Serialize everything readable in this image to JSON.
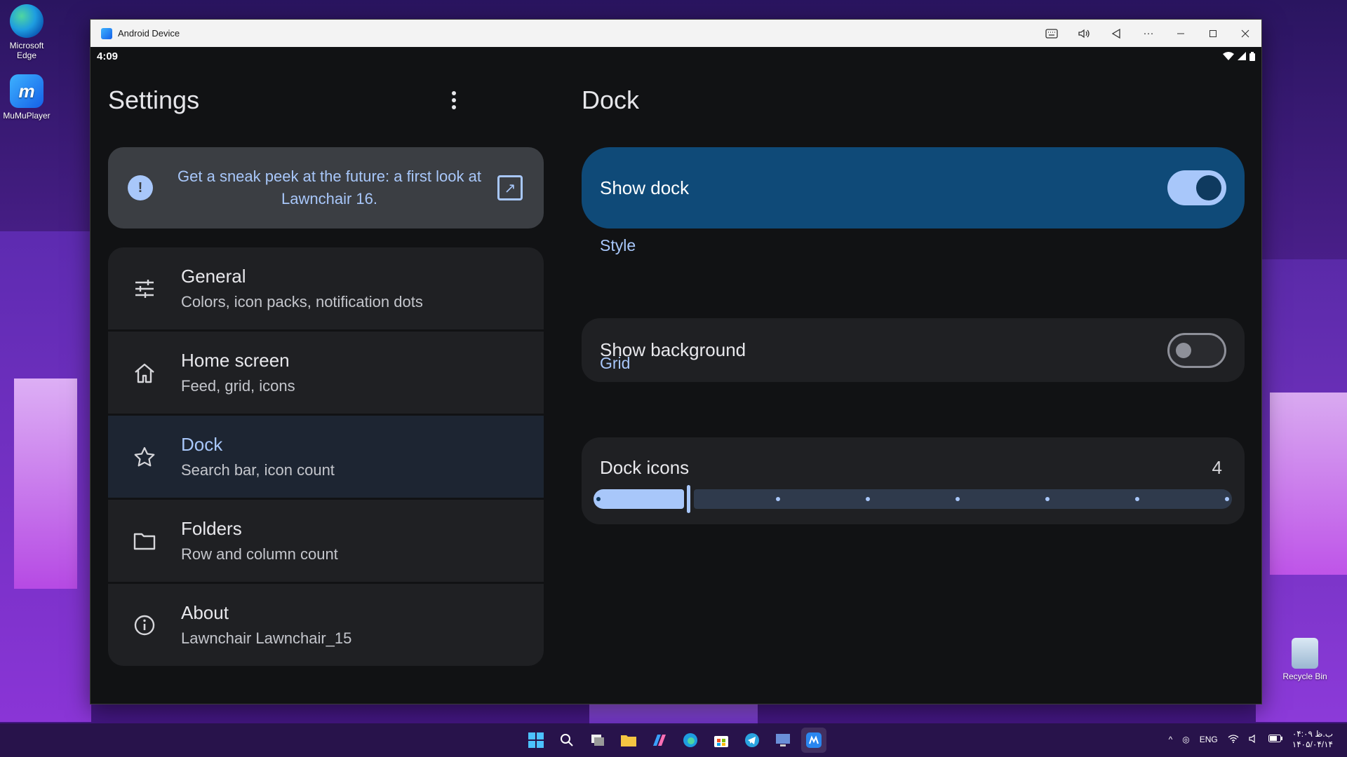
{
  "desktop": {
    "icons": [
      {
        "label": "Microsoft Edge"
      },
      {
        "label": "MuMuPlayer"
      },
      {
        "label": "Recycle Bin"
      }
    ]
  },
  "window": {
    "title": "Android Device",
    "controls": [
      "keyboard-icon",
      "volume-icon",
      "back-icon",
      "more-icon",
      "minimize-icon",
      "maximize-icon",
      "close-icon"
    ]
  },
  "statusbar": {
    "time": "4:09"
  },
  "settings": {
    "title": "Settings",
    "banner": {
      "text": "Get a sneak peek at the future: a first look at Lawnchair 16."
    },
    "items": [
      {
        "title": "General",
        "subtitle": "Colors, icon packs, notification dots",
        "icon": "sliders-icon"
      },
      {
        "title": "Home screen",
        "subtitle": "Feed, grid, icons",
        "icon": "home-icon"
      },
      {
        "title": "Dock",
        "subtitle": "Search bar, icon count",
        "icon": "star-icon",
        "active": true
      },
      {
        "title": "Folders",
        "subtitle": "Row and column count",
        "icon": "folder-icon"
      },
      {
        "title": "About",
        "subtitle": "Lawnchair Lawnchair_15",
        "icon": "info-icon"
      }
    ]
  },
  "dock": {
    "title": "Dock",
    "show_dock": {
      "label": "Show dock",
      "enabled": true
    },
    "style_header": "Style",
    "show_background": {
      "label": "Show background",
      "enabled": false
    },
    "grid_header": "Grid",
    "dock_icons": {
      "label": "Dock icons",
      "value": "4",
      "min": 3,
      "max": 10,
      "current": 4
    }
  },
  "taskbar": {
    "lang": "ENG",
    "time": "ب.ظ ۰۴:۰۹",
    "date": "۱۴۰۵/۰۴/۱۴"
  },
  "colors": {
    "accent": "#a8c7fa",
    "show_dock_bg": "#0f4a78",
    "surface": "#1f2023",
    "background": "#111214"
  }
}
